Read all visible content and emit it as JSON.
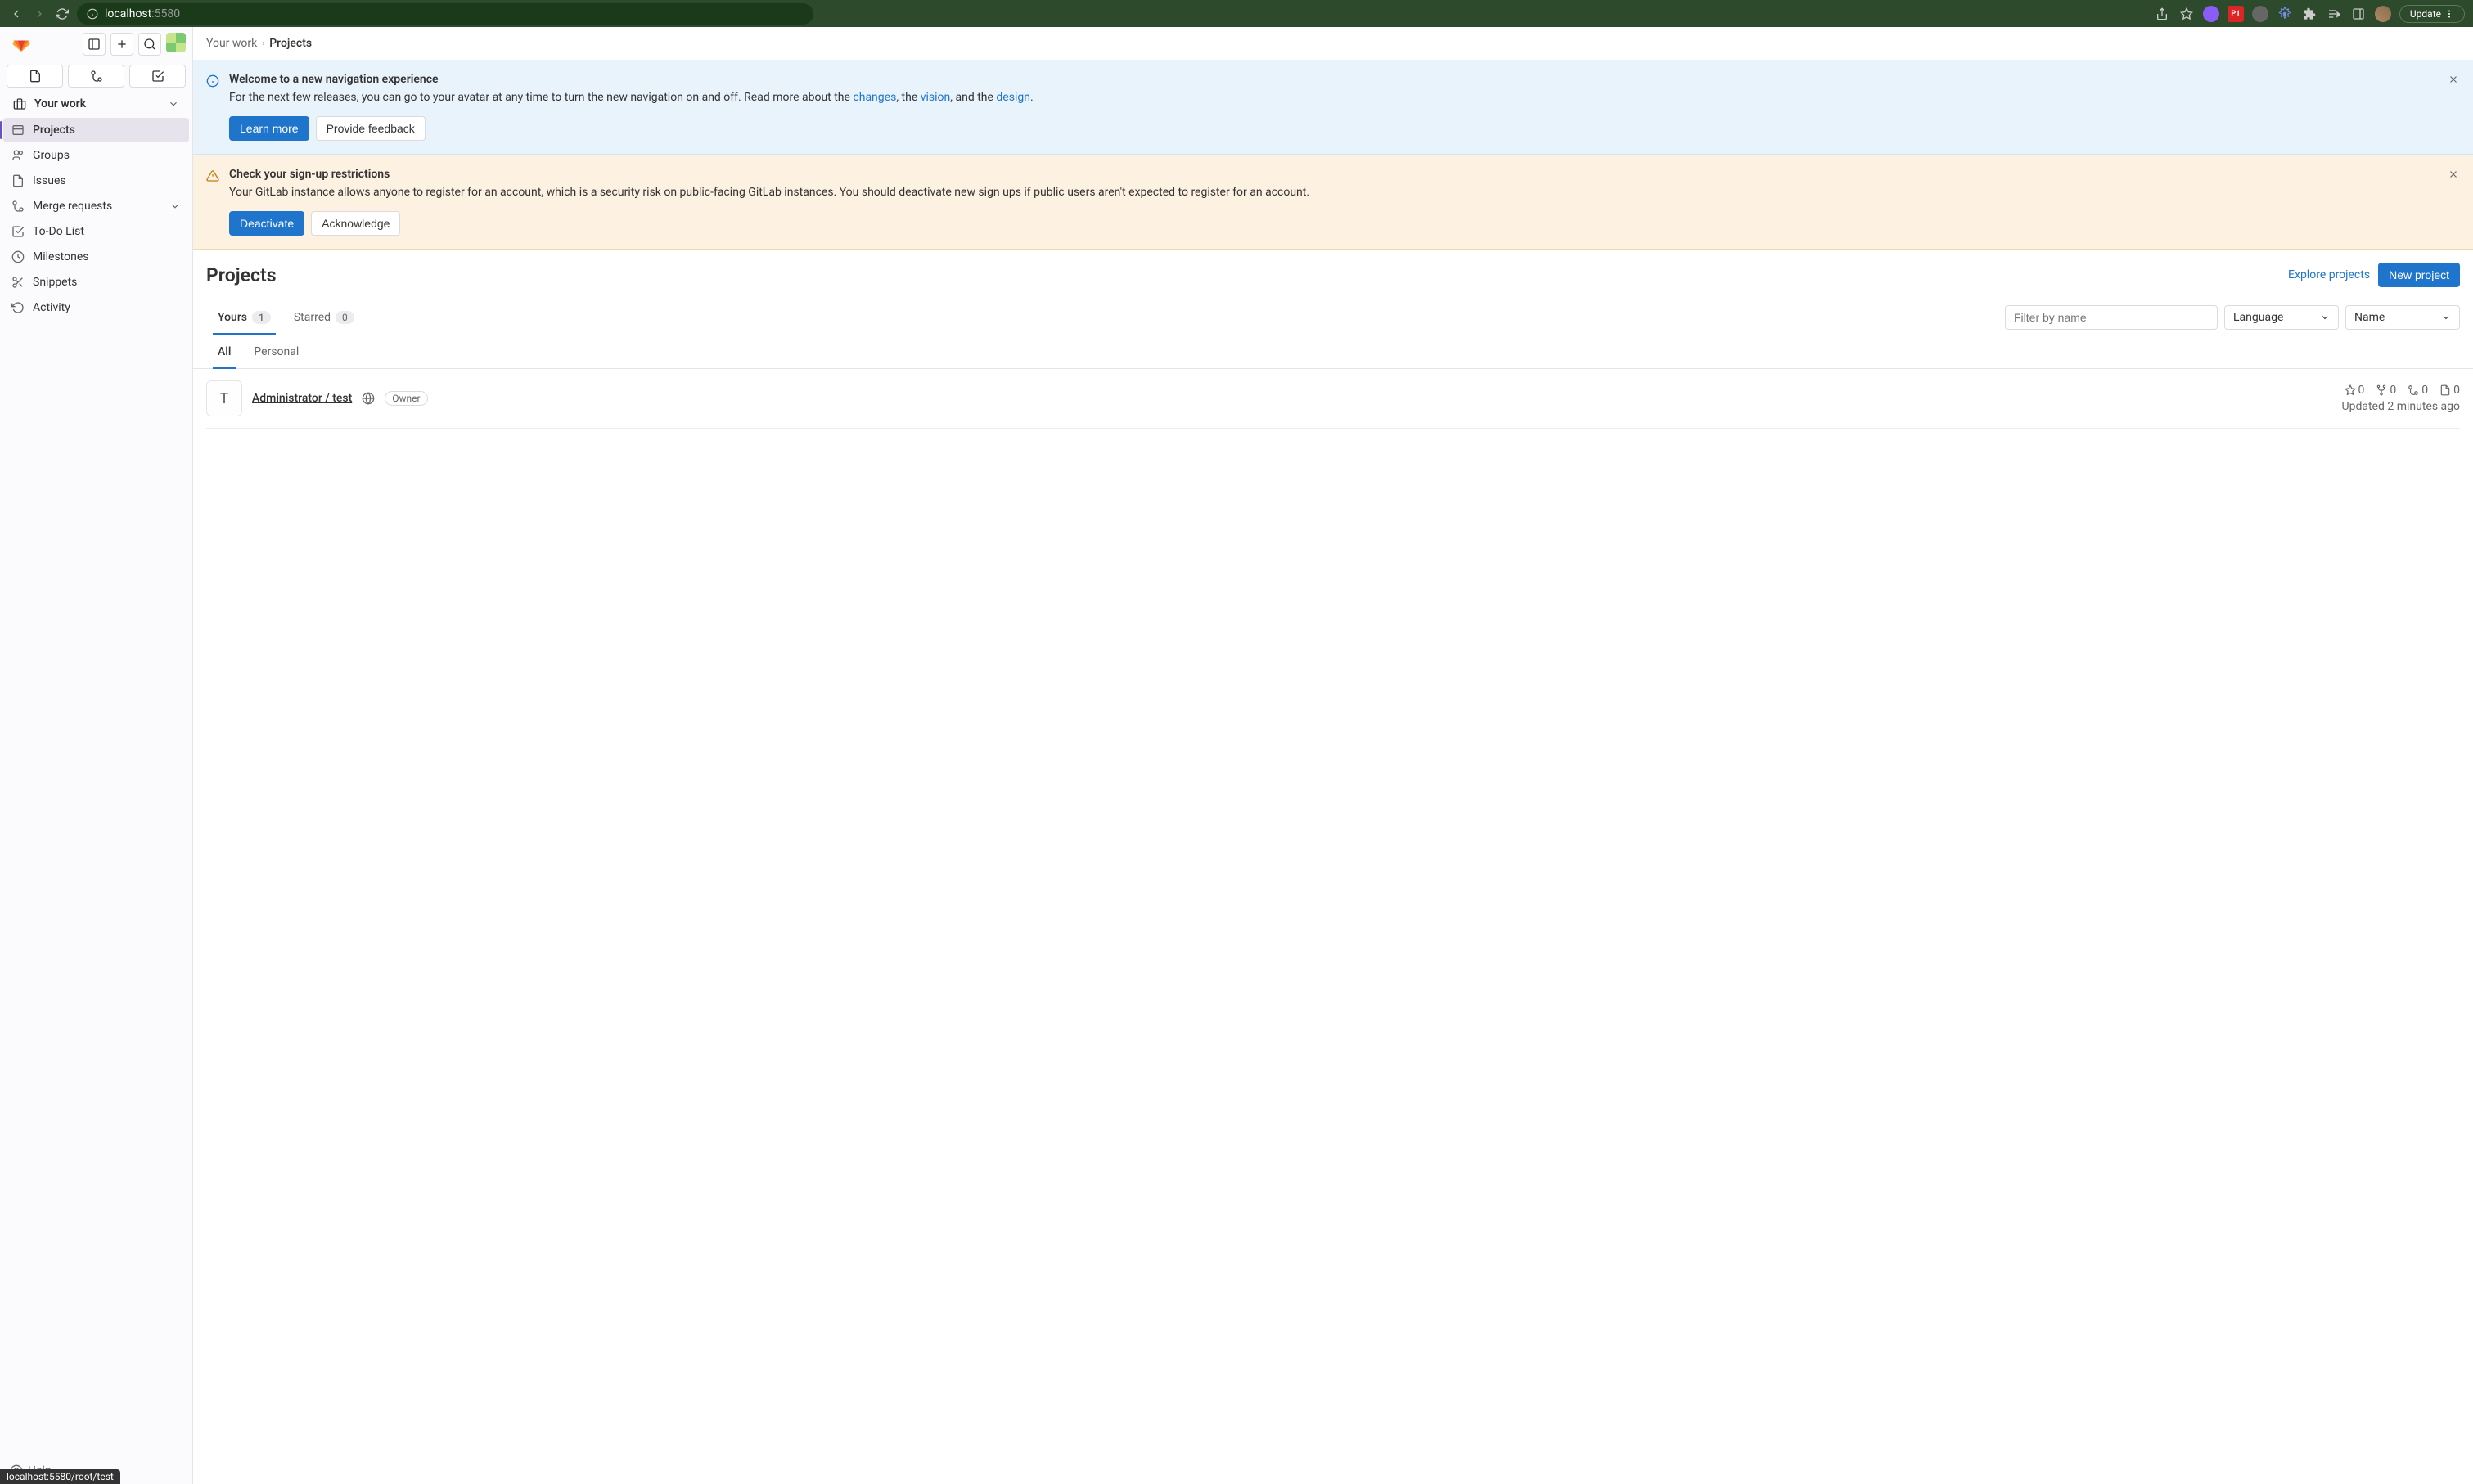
{
  "browser": {
    "host": "localhost",
    "port": ":5580",
    "update_label": "Update",
    "ext_p1_label": "P1"
  },
  "sidebar": {
    "heading": "Your work",
    "items": [
      {
        "label": "Projects"
      },
      {
        "label": "Groups"
      },
      {
        "label": "Issues"
      },
      {
        "label": "Merge requests"
      },
      {
        "label": "To-Do List"
      },
      {
        "label": "Milestones"
      },
      {
        "label": "Snippets"
      },
      {
        "label": "Activity"
      }
    ],
    "help_label": "Help"
  },
  "breadcrumb": {
    "root": "Your work",
    "current": "Projects"
  },
  "banners": {
    "info": {
      "title": "Welcome to a new navigation experience",
      "text_pre": "For the next few releases, you can go to your avatar at any time to turn the new navigation on and off. Read more about the ",
      "link1": "changes",
      "text_mid1": ", the ",
      "link2": "vision",
      "text_mid2": ", and the ",
      "link3": "design",
      "text_post": ".",
      "btn1": "Learn more",
      "btn2": "Provide feedback"
    },
    "warn": {
      "title": "Check your sign-up restrictions",
      "text": "Your GitLab instance allows anyone to register for an account, which is a security risk on public-facing GitLab instances. You should deactivate new sign ups if public users aren't expected to register for an account.",
      "btn1": "Deactivate",
      "btn2": "Acknowledge"
    }
  },
  "page": {
    "title": "Projects",
    "explore_link": "Explore projects",
    "new_btn": "New project"
  },
  "tabs": {
    "yours_label": "Yours",
    "yours_count": "1",
    "starred_label": "Starred",
    "starred_count": "0",
    "filter_placeholder": "Filter by name",
    "language_label": "Language",
    "sort_label": "Name"
  },
  "subtabs": {
    "all": "All",
    "personal": "Personal"
  },
  "project": {
    "initial": "T",
    "name": "Administrator / test",
    "role": "Owner",
    "stars": "0",
    "forks": "0",
    "mrs": "0",
    "issues": "0",
    "updated": "Updated 2 minutes ago"
  },
  "status_tooltip": "localhost:5580/root/test"
}
